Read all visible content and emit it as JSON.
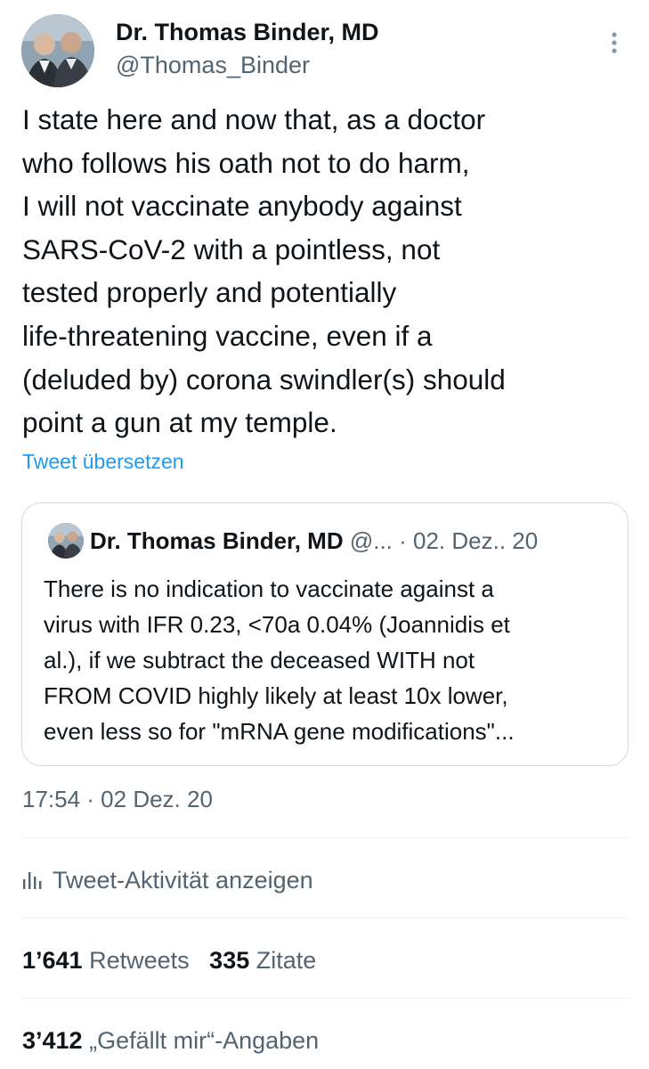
{
  "author": {
    "name": "Dr. Thomas Binder, MD",
    "handle": "@Thomas_Binder"
  },
  "tweet": {
    "lines": [
      "I state here and now that, as a doctor",
      "who follows his oath not to do harm,",
      "I will not vaccinate anybody against",
      "SARS-CoV-2 with a pointless, not",
      "tested properly and potentially",
      "life-threatening vaccine, even if a",
      "(deluded by) corona swindler(s) should",
      "point a gun at my temple."
    ],
    "translate_label": "Tweet übersetzen",
    "timestamp": "17:54 · 02 Dez. 20"
  },
  "quote": {
    "name": "Dr. Thomas Binder, MD",
    "handle_date": " @... · 02. Dez.. 20",
    "lines": [
      "There is no indication to vaccinate against a",
      "virus with IFR 0.23, <70a 0.04% (Joannidis et",
      "al.), if we subtract the deceased WITH not",
      "FROM COVID highly likely at least 10x lower,",
      "even less so for \"mRNA gene modifications\"..."
    ]
  },
  "activity": {
    "label": "Tweet-Aktivität anzeigen",
    "icon": "bar-chart-icon"
  },
  "stats": {
    "retweets_count": "1’641",
    "retweets_label": "Retweets",
    "quotes_count": "335",
    "quotes_label": "Zitate",
    "likes_count": "3’412",
    "likes_label": "„Gefällt mir“-Angaben"
  },
  "icons": {
    "more": "more-vertical-icon"
  },
  "colors": {
    "text": "#0f1419",
    "secondary": "#536471",
    "link": "#1d9bf0",
    "border": "#cfd9de",
    "divider": "#eff3f4"
  }
}
